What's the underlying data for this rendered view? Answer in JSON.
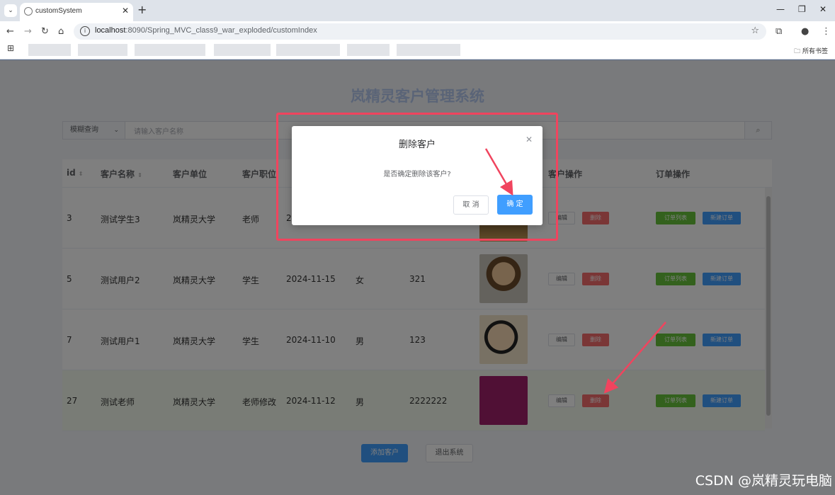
{
  "browser": {
    "tab_title": "customSystem",
    "url_host": "localhost",
    "url_rest": ":8090/Spring_MVC_class9_war_exploded/customIndex",
    "all_bookmarks": "所有书签"
  },
  "app": {
    "title": "岚精灵客户管理系统",
    "search": {
      "mode": "模糊查询",
      "placeholder": "请输入客户名称"
    },
    "columns": [
      "id",
      "客户名称",
      "客户单位",
      "客户职位",
      "客户操作",
      "订单操作"
    ],
    "rows": [
      {
        "id": "3",
        "name": "测试学生3",
        "unit": "岚精灵大学",
        "position": "老师",
        "date": "2",
        "gender": "",
        "phone": ""
      },
      {
        "id": "5",
        "name": "测试用户2",
        "unit": "岚精灵大学",
        "position": "学生",
        "date": "2024-11-15",
        "gender": "女",
        "phone": "321"
      },
      {
        "id": "7",
        "name": "测试用户1",
        "unit": "岚精灵大学",
        "position": "学生",
        "date": "2024-11-10",
        "gender": "男",
        "phone": "123"
      },
      {
        "id": "27",
        "name": "测试老师",
        "unit": "岚精灵大学",
        "position": "老师修改",
        "date": "2024-11-12",
        "gender": "男",
        "phone": "2222222"
      }
    ],
    "row_buttons": {
      "edit": "编辑",
      "delete": "删除",
      "orders": "订单列表",
      "new_order": "新建订单"
    },
    "add_button": "添加客户",
    "exit_button": "退出系统"
  },
  "dialog": {
    "title": "删除客户",
    "message": "是否确定删除该客户?",
    "cancel": "取 消",
    "confirm": "确 定"
  },
  "watermark": "CSDN @岚精灵玩电脑"
}
